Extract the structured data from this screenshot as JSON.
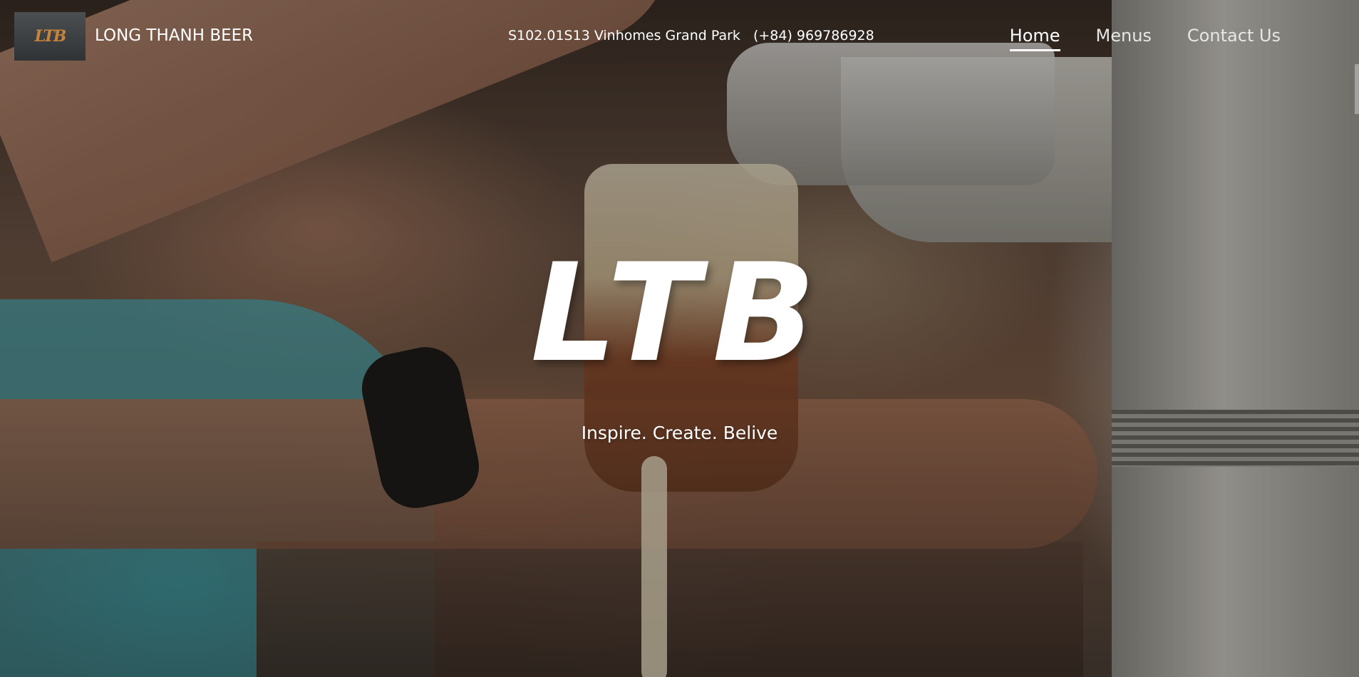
{
  "header": {
    "logo_text": "LTB",
    "brand_name": "LONG THANH BEER",
    "address": "S102.01S13 Vinhomes Grand Park",
    "phone": "(+84) 969786928"
  },
  "nav": {
    "items": [
      {
        "label": "Home",
        "active": true
      },
      {
        "label": "Menus",
        "active": false
      },
      {
        "label": "Contact Us",
        "active": false
      }
    ]
  },
  "hero": {
    "title": "LTB",
    "subtitle": "Inspire. Create. Belive"
  },
  "colors": {
    "logo_accent": "#c8843a",
    "text": "#ffffff"
  }
}
